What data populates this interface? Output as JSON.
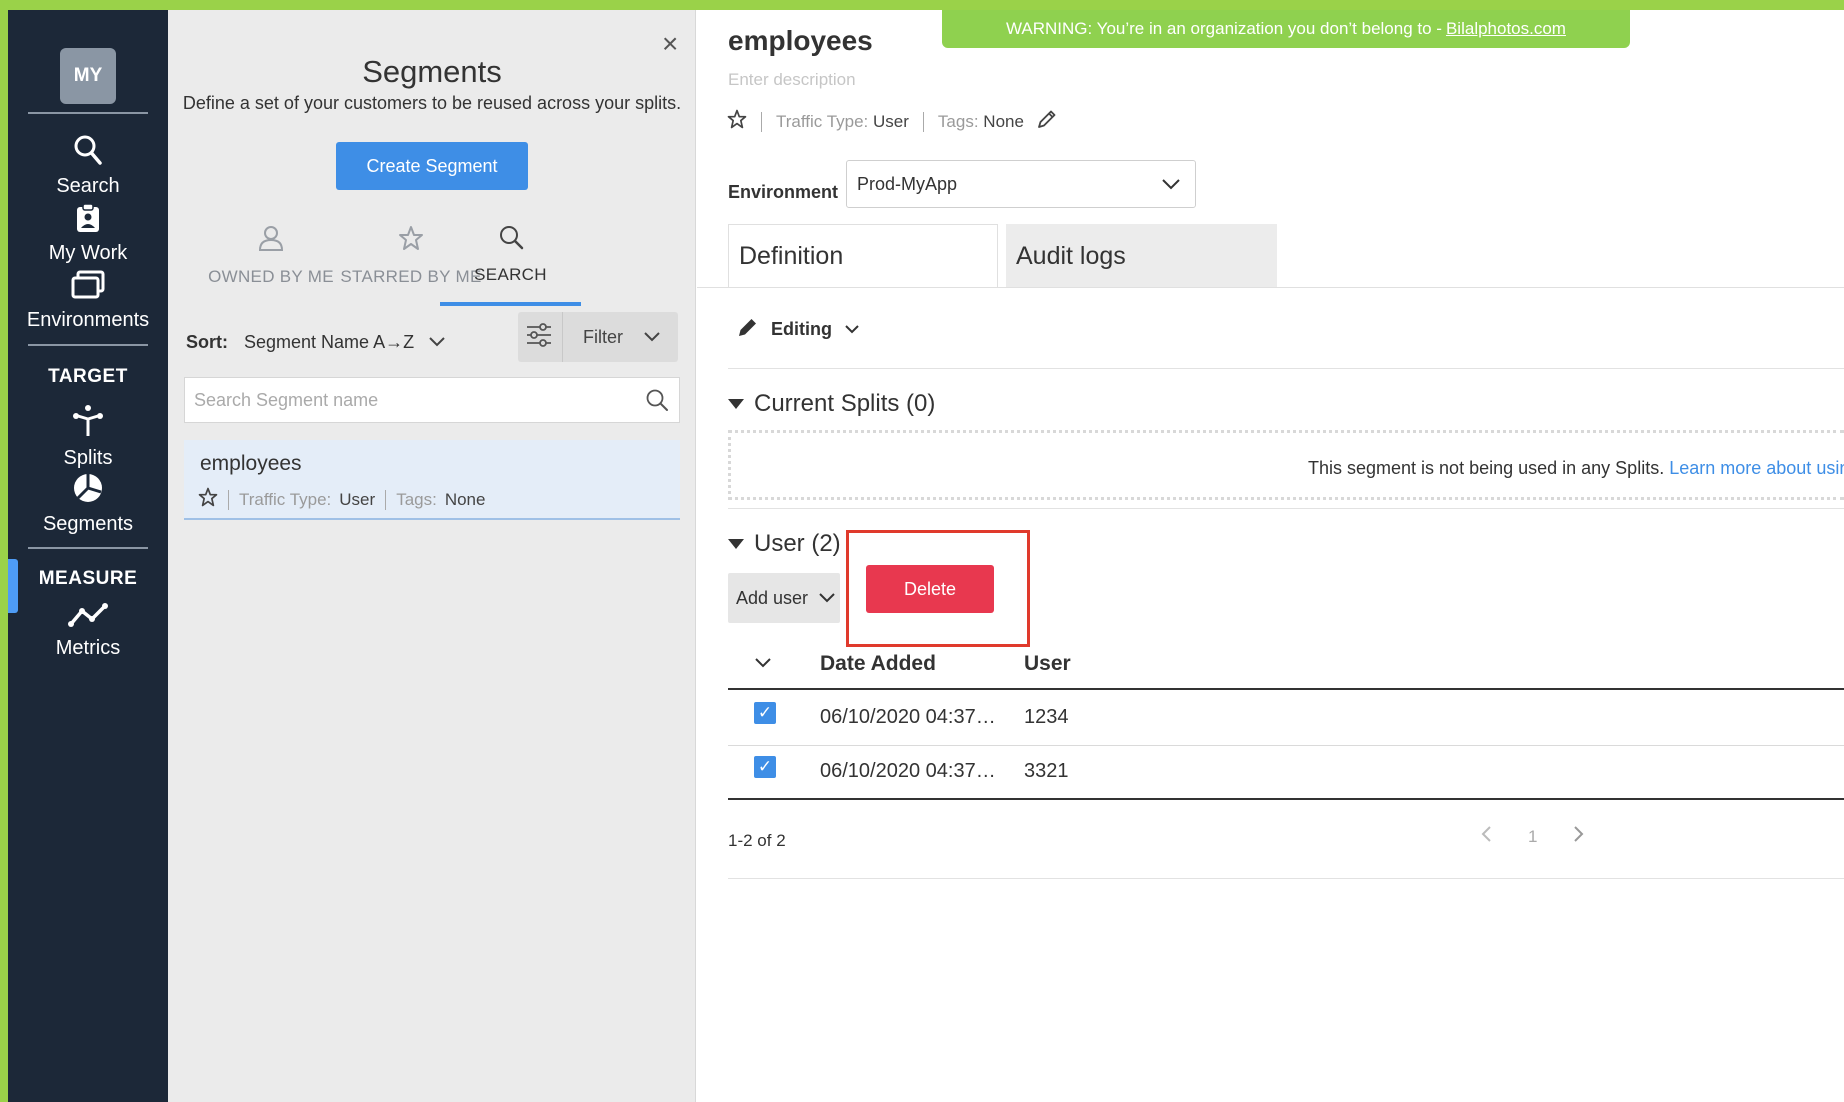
{
  "nav": {
    "avatar": "MY",
    "items": [
      {
        "label": "Search",
        "icon": "search-icon"
      },
      {
        "label": "My Work",
        "icon": "clipboard-icon"
      },
      {
        "label": "Environments",
        "icon": "environments-icon"
      }
    ],
    "target_heading": "TARGET",
    "target_items": [
      {
        "label": "Splits",
        "icon": "splits-icon"
      },
      {
        "label": "Segments",
        "icon": "segments-icon"
      }
    ],
    "measure_heading": "MEASURE",
    "measure_items": [
      {
        "label": "Metrics",
        "icon": "metrics-icon"
      }
    ],
    "active_item": "Segments",
    "accent_color": "#4e9cf5"
  },
  "segments_panel": {
    "close": "×",
    "title": "Segments",
    "subtitle": "Define a set of your customers to be reused across your splits.",
    "create_button": "Create Segment",
    "tabs": [
      {
        "label": "OWNED BY ME",
        "icon": "user-icon"
      },
      {
        "label": "STARRED BY ME",
        "icon": "star-icon"
      },
      {
        "label": "SEARCH",
        "icon": "search-icon",
        "active": true
      }
    ],
    "sort_label": "Sort:",
    "sort_value": "Segment Name A→Z",
    "filter_label": "Filter",
    "search_placeholder": "Search Segment name",
    "list": [
      {
        "name": "employees",
        "traffic_type_label": "Traffic Type:",
        "traffic_type": "User",
        "tags_label": "Tags:",
        "tags": "None"
      }
    ]
  },
  "warning": {
    "text": "WARNING: You’re in an organization you don’t belong to -",
    "link": "Bilalphotos.com"
  },
  "segment": {
    "title": "employees",
    "description_placeholder": "Enter description",
    "traffic_type_label": "Traffic Type:",
    "traffic_type": "User",
    "tags_label": "Tags:",
    "tags": "None",
    "environment_label": "Environment",
    "environment": "Prod-MyApp",
    "tabs": [
      "Definition",
      "Audit logs"
    ],
    "active_tab": "Definition",
    "mode": "Editing",
    "current_splits": {
      "title": "Current Splits (0)",
      "message": "This segment is not being used in any Splits.",
      "link": "Learn more about usin"
    },
    "users": {
      "title": "User (2)",
      "add_label": "Add user",
      "delete_label": "Delete",
      "columns": [
        "Date Added",
        "User"
      ],
      "rows": [
        {
          "date": "06/10/2020 04:37…",
          "user": "1234",
          "checked": true
        },
        {
          "date": "06/10/2020 04:37…",
          "user": "3321",
          "checked": true
        }
      ],
      "range": "1-2 of 2",
      "page": "1"
    }
  },
  "colors": {
    "nav_bg": "#1c2838",
    "brand_green": "#9ad249",
    "primary_blue": "#3e8ee6",
    "danger_red": "#e8384f",
    "highlight_red": "#e03a2c"
  }
}
